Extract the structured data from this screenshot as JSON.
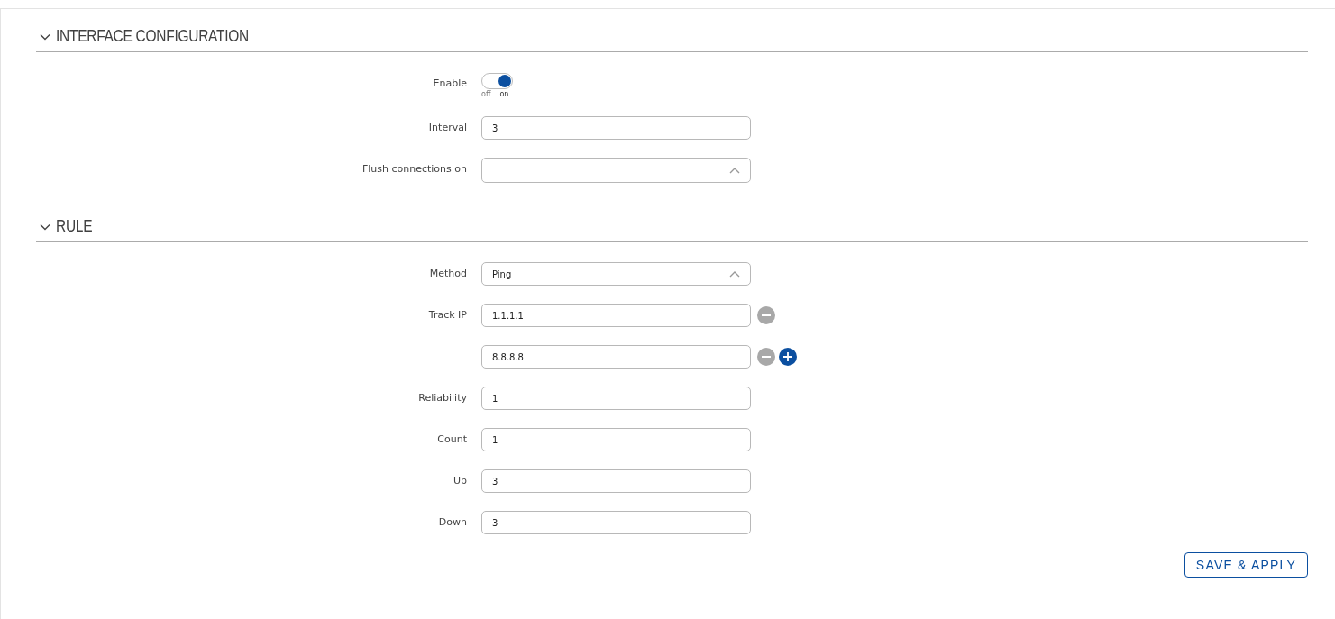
{
  "sections": [
    {
      "title": "INTERFACE CONFIGURATION",
      "expanded": true,
      "fields": [
        {
          "kind": "toggle",
          "label": "Enable",
          "on": true,
          "off_label": "off",
          "on_label": "on"
        },
        {
          "kind": "text",
          "label": "Interval",
          "value": "3"
        },
        {
          "kind": "select",
          "label": "Flush connections on"
        }
      ]
    },
    {
      "title": "RULE",
      "expanded": true,
      "fields": [
        {
          "kind": "select",
          "label": "Method",
          "value": "Ping"
        },
        {
          "kind": "list",
          "label": "Track IP",
          "values": [
            "1.1.1.1",
            "8.8.8.8"
          ]
        },
        {
          "kind": "text",
          "label": "Reliability",
          "value": "1"
        },
        {
          "kind": "text",
          "label": "Count",
          "value": "1"
        },
        {
          "kind": "text",
          "label": "Up",
          "value": "3"
        },
        {
          "kind": "text",
          "label": "Down",
          "value": "3"
        }
      ]
    }
  ],
  "save_button": "SAVE & APPLY"
}
